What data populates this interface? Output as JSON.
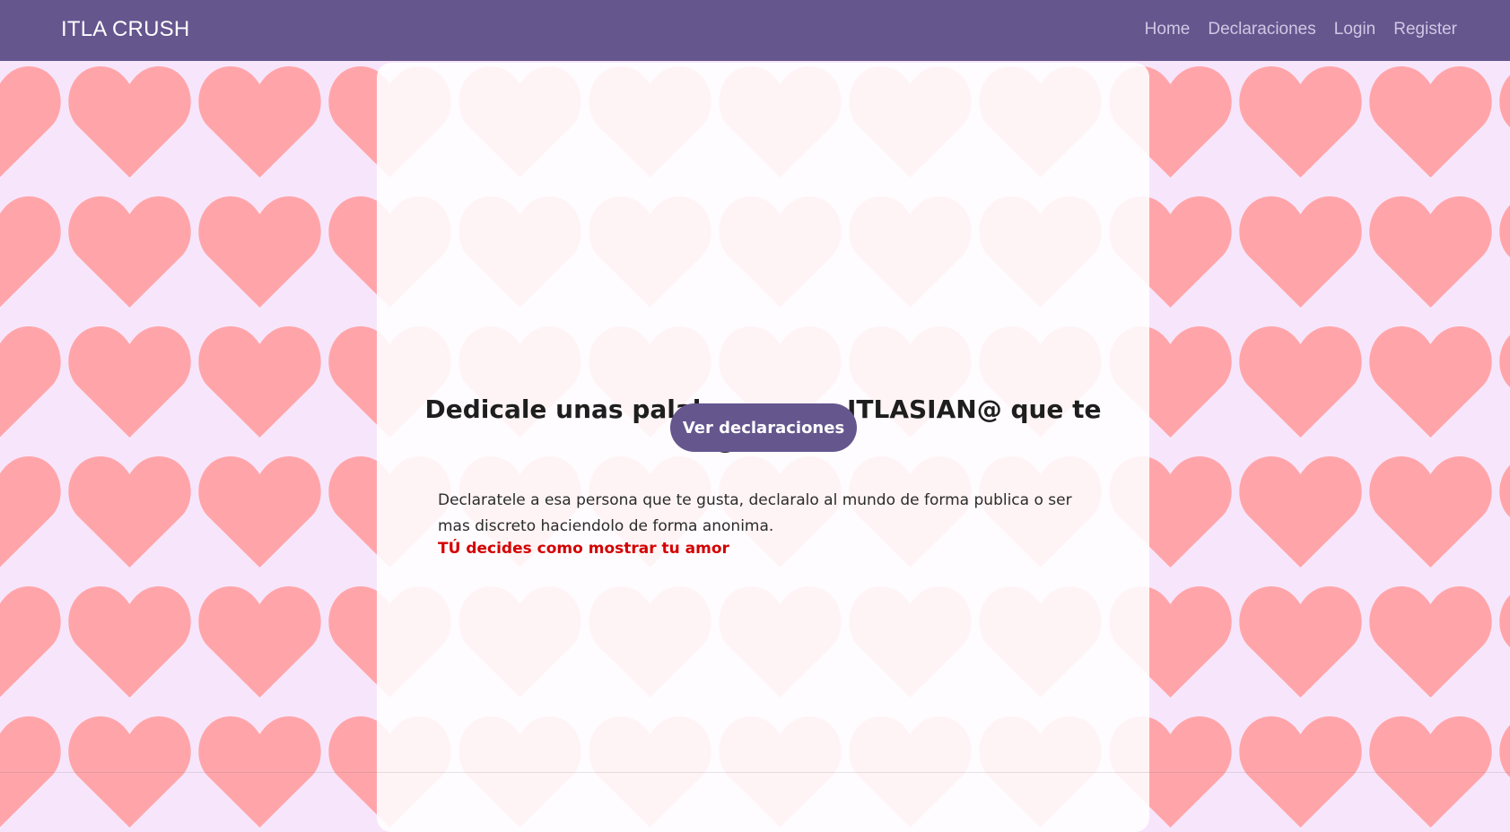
{
  "navbar": {
    "brand": "ITLA CRUSH",
    "links": [
      {
        "label": "Home"
      },
      {
        "label": "Declaraciones"
      },
      {
        "label": "Login"
      },
      {
        "label": "Register"
      }
    ]
  },
  "hero": {
    "headline": "Dedicale unas palabras a ese ITLASIAN@ que te gusta!",
    "button_label": "Ver declaraciones",
    "description": "Declaratele a esa persona que te gusta, declaralo al mundo de forma publica o ser mas discreto haciendolo de forma anonima.",
    "highlight": "TÚ decides como mostrar tu amor"
  },
  "colors": {
    "navbar": "#65568e",
    "heart": "#ffa5a9",
    "background": "#f7e6fb",
    "highlight": "#d40000"
  },
  "background_pattern": "heart-icon"
}
